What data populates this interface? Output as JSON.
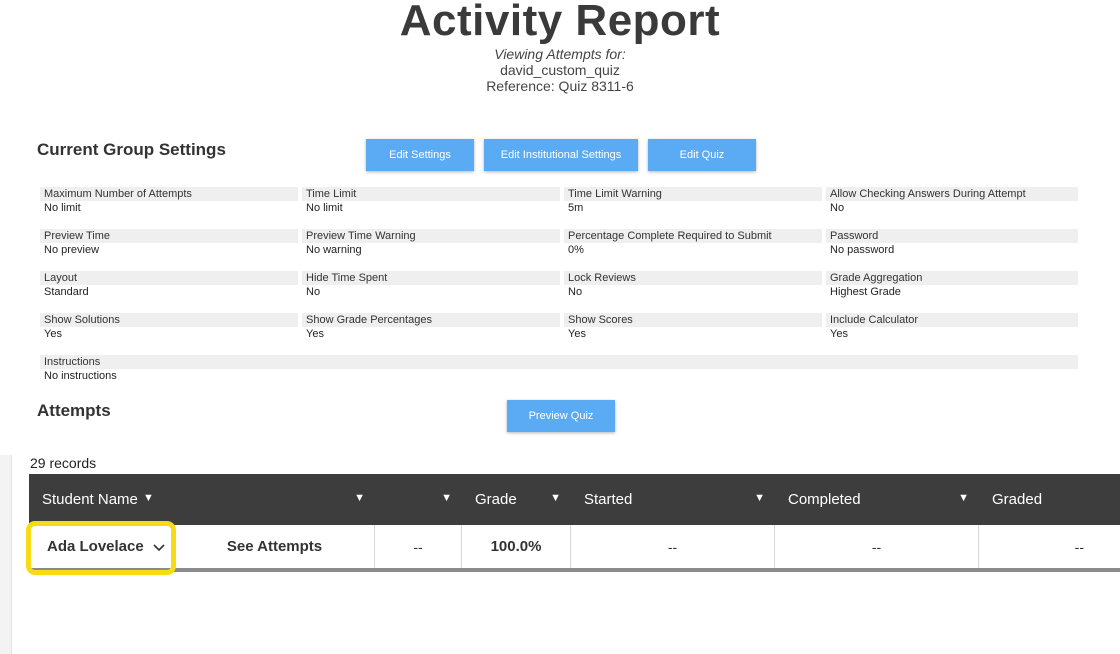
{
  "header": {
    "title": "Activity Report",
    "viewing": "Viewing Attempts for:",
    "quiz_name": "david_custom_quiz",
    "reference": "Reference: Quiz 8311-6"
  },
  "group_settings": {
    "title": "Current Group Settings",
    "buttons": [
      "Edit Settings",
      "Edit Institutional Settings",
      "Edit Quiz"
    ],
    "items": [
      {
        "label": "Maximum Number of Attempts",
        "value": "No limit"
      },
      {
        "label": "Time Limit",
        "value": "No limit"
      },
      {
        "label": "Time Limit Warning",
        "value": "5m"
      },
      {
        "label": "Allow Checking Answers During Attempt",
        "value": "No"
      },
      {
        "label": "Preview Time",
        "value": "No preview"
      },
      {
        "label": "Preview Time Warning",
        "value": "No warning"
      },
      {
        "label": "Percentage Complete Required to Submit",
        "value": "0%"
      },
      {
        "label": "Password",
        "value": "No password"
      },
      {
        "label": "Layout",
        "value": "Standard"
      },
      {
        "label": "Hide Time Spent",
        "value": "No"
      },
      {
        "label": "Lock Reviews",
        "value": "No"
      },
      {
        "label": "Grade Aggregation",
        "value": "Highest Grade"
      },
      {
        "label": "Show Solutions",
        "value": "Yes"
      },
      {
        "label": "Show Grade Percentages",
        "value": "Yes"
      },
      {
        "label": "Show Scores",
        "value": "Yes"
      },
      {
        "label": "Include Calculator",
        "value": "Yes"
      },
      {
        "label": "Instructions",
        "value": "No instructions"
      }
    ]
  },
  "attempts": {
    "title": "Attempts",
    "preview_button": "Preview Quiz",
    "records": "29 records",
    "columns": [
      "Student Name",
      "",
      "",
      "Grade",
      "Started",
      "Completed",
      "Graded"
    ],
    "rows": [
      {
        "student": "Ada Lovelace",
        "link": "See Attempts",
        "col3": "--",
        "grade": "100.0%",
        "started": "--",
        "completed": "--",
        "graded": "--"
      }
    ]
  },
  "colors": {
    "button": "#5aabf4",
    "table_header": "#3d3d3d",
    "highlight": "#f7dc15"
  }
}
